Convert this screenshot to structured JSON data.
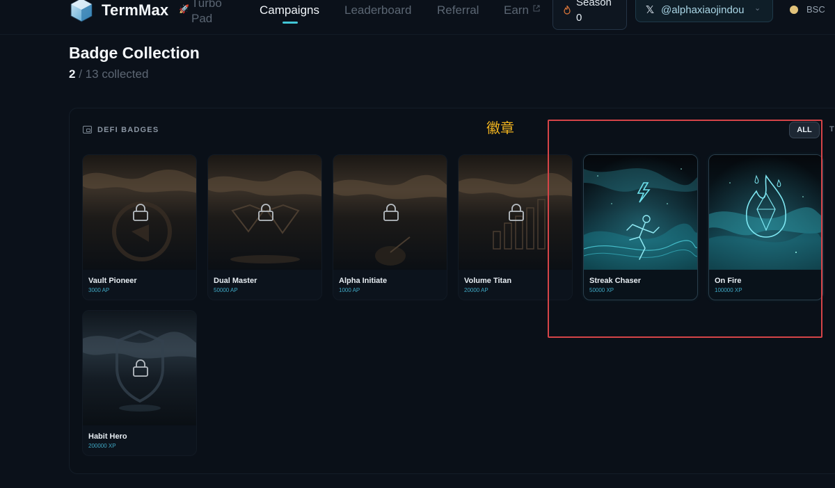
{
  "brand": {
    "name": "TermMax",
    "turbo_pad": "Turbo Pad"
  },
  "nav": {
    "items": [
      {
        "label": "Campaigns",
        "active": true
      },
      {
        "label": "Leaderboard",
        "active": false
      },
      {
        "label": "Referral",
        "active": false
      },
      {
        "label": "Earn",
        "active": false,
        "external": true
      }
    ]
  },
  "season": {
    "label": "Season",
    "value": "0"
  },
  "account": {
    "handle": "@alphaxiaojindou"
  },
  "network": {
    "label": "BSC"
  },
  "page": {
    "title": "Badge Collection",
    "collected_count": "2",
    "collected_separator": "/",
    "collected_total": "13",
    "collected_word": "collected"
  },
  "section": {
    "label": "DEFI BADGES",
    "annotation": "徽章"
  },
  "filters": {
    "active": "ALL",
    "next_partial": "T"
  },
  "badges": [
    {
      "name": "Vault Pioneer",
      "points": "3000 AP",
      "unlocked": false,
      "art": "vault-icon"
    },
    {
      "name": "Dual Master",
      "points": "50000 AP",
      "unlocked": false,
      "art": "diamond-icon"
    },
    {
      "name": "Alpha Initiate",
      "points": "1000 AP",
      "unlocked": false,
      "art": "dart-icon"
    },
    {
      "name": "Volume Titan",
      "points": "20000 AP",
      "unlocked": false,
      "art": "bar-chart-icon"
    },
    {
      "name": "Streak Chaser",
      "points": "50000 XP",
      "unlocked": true,
      "art": "runner-icon"
    },
    {
      "name": "On Fire",
      "points": "100000 XP",
      "unlocked": true,
      "art": "flame-icon"
    },
    {
      "name": "Habit Hero",
      "points": "200000 XP",
      "unlocked": false,
      "art": "shield-icon"
    }
  ],
  "colors": {
    "accent": "#42c6d6",
    "background": "#0b111a",
    "annotation": "#efb21f",
    "highlight": "#d64448"
  }
}
